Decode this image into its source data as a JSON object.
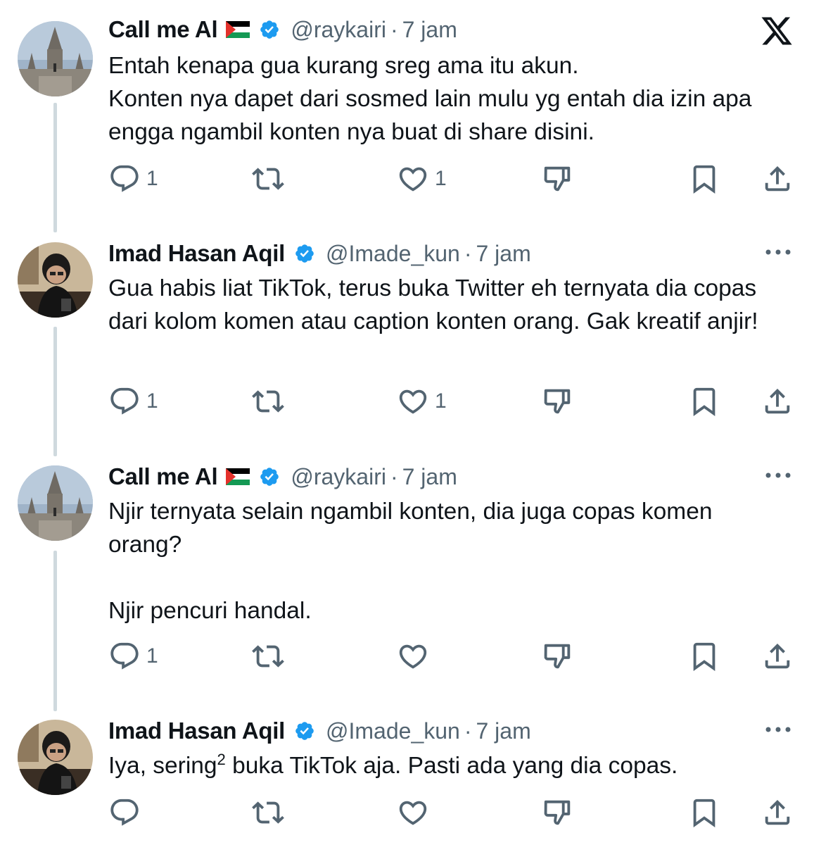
{
  "tweets": [
    {
      "name": "Call me Al",
      "handle": "@raykairi",
      "dot": "·",
      "time": "7 jam",
      "text": "Entah kenapa gua kurang sreg ama itu akun.\nKonten nya dapet dari sosmed lain mulu yg entah dia izin apa engga ngambil konten nya buat di share disini.",
      "reply_count": "1",
      "like_count": "1"
    },
    {
      "name": "Imad Hasan Aqil",
      "handle": "@Imade_kun",
      "dot": "·",
      "time": "7 jam",
      "text": "Gua habis liat TikTok, terus buka Twitter eh ternyata dia copas dari kolom komen atau caption konten orang. Gak kreatif anjir!",
      "reply_count": "1",
      "like_count": "1"
    },
    {
      "name": "Call me Al",
      "handle": "@raykairi",
      "dot": "·",
      "time": "7 jam",
      "text": "Njir ternyata selain ngambil konten, dia juga copas komen orang?\n\nNjir pencuri handal.",
      "reply_count": "1",
      "like_count": ""
    },
    {
      "name": "Imad Hasan Aqil",
      "handle": "@Imade_kun",
      "dot": "·",
      "time": "7 jam",
      "text_before": "Iya, sering",
      "text_sup": "2",
      "text_after": " buka TikTok aja. Pasti ada yang dia copas.",
      "reply_count": "",
      "like_count": ""
    }
  ],
  "icons": {
    "reply": "reply-icon",
    "retweet": "retweet-icon",
    "like": "heart-icon",
    "dislike": "downvote-icon",
    "bookmark": "bookmark-icon",
    "share": "share-icon",
    "more": "more-icon",
    "x_logo": "x-logo-icon",
    "verified": "verified-badge-icon",
    "flag": "palestine-flag-icon"
  },
  "colors": {
    "verified": "#1d9bf0",
    "secondary_text": "#536471",
    "thread_line": "#cfd9de"
  }
}
